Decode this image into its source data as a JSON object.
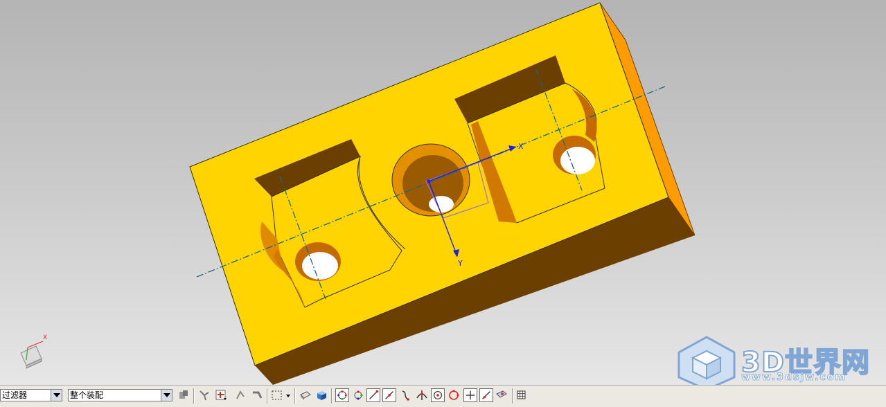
{
  "viewport": {
    "part_color": "#ffd400",
    "part_shadow_color": "#6b3f00",
    "part_side_color": "#ff9a00",
    "csys_labels": {
      "x": "X",
      "y": "Y"
    },
    "triad_label_x": "X"
  },
  "watermark": {
    "title": "3D世界网",
    "url": "www.3dsjw.com"
  },
  "toolbar": {
    "filter_select": {
      "value": "过滤器"
    },
    "scope_select": {
      "value": "整个装配"
    },
    "icons": [
      "general-select-icon",
      "feature-select-icon",
      "feature-filter-icon",
      "select-face-icon",
      "select-body-icon",
      "rectangle-select-icon",
      "dropdown-arrow-icon",
      "shaded-view-icon",
      "solid-cube-icon",
      "snap-point-icon",
      "snap-point-alt-icon",
      "endpoint-icon",
      "midpoint-icon",
      "curve-point-icon",
      "intersection-icon",
      "arc-center-icon",
      "quadrant-icon",
      "existing-point-icon",
      "point-on-curve-icon",
      "point-on-face-icon",
      "grid-icon"
    ]
  }
}
